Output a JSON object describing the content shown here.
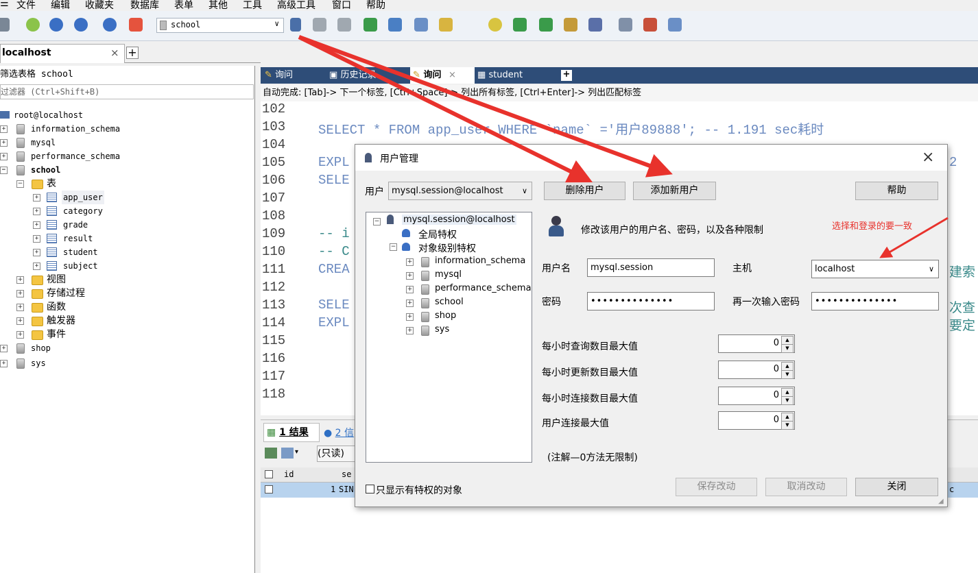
{
  "menu": [
    "文件",
    "编辑",
    "收藏夹",
    "数据库",
    "表单",
    "其他",
    "工具",
    "高级工具",
    "窗口",
    "帮助"
  ],
  "toolbar": {
    "db_select": "school"
  },
  "connection_tab": {
    "label": "localhost",
    "close": "×",
    "add": "+"
  },
  "left": {
    "filter_title": "筛选表格 school",
    "filter_placeholder": "过滤器 (Ctrl+Shift+B)",
    "root": "root@localhost",
    "dbs": [
      "information_schema",
      "mysql",
      "performance_schema",
      "school"
    ],
    "school_children": [
      "表",
      "视图",
      "存储过程",
      "函数",
      "触发器",
      "事件"
    ],
    "tables": [
      "app_user",
      "category",
      "grade",
      "result",
      "student",
      "subject"
    ],
    "more_dbs": [
      "shop",
      "sys"
    ]
  },
  "editor": {
    "tabs": [
      "询问",
      "历史记录",
      "询问",
      "student"
    ],
    "autocomplete": "自动完成:  [Tab]-> 下一个标签,  [Ctrl+Space]-> 列出所有标签,  [Ctrl+Enter]-> 列出匹配标签",
    "line_numbers": [
      "102",
      "103",
      "104",
      "105",
      "106",
      "107",
      "108",
      "109",
      "110",
      "111",
      "112",
      "113",
      "114",
      "115",
      "116",
      "117",
      "118"
    ],
    "line103": "SELECT * FROM app_user WHERE `name` ='用户89888'; -- 1.191 sec耗时",
    "line105": "EXPL",
    "line105_tail": "2",
    "line106": "SELE",
    "line109": "-- i",
    "line110": "-- C",
    "line111": "CREA",
    "line111_tail": "建索",
    "line113": "SELE",
    "line113_tail": "次查",
    "line114": "EXPL",
    "line114_tail": "要定"
  },
  "result": {
    "tab1": "1 结果",
    "tab2": "2 信",
    "readonly": "(只读)",
    "col_id": "id",
    "col_se": "se",
    "row_id": "1",
    "row_val": "SIN",
    "row_tail": "c"
  },
  "dialog": {
    "title": "用户管理",
    "close": "×",
    "user_label": "用户",
    "user_value": "mysql.session@localhost",
    "delete_btn": "删除用户",
    "add_btn": "添加新用户",
    "help_btn": "帮助",
    "tree_root": "mysql.session@localhost",
    "tree_global": "全局特权",
    "tree_object": "对象级别特权",
    "tree_dbs": [
      "information_schema",
      "mysql",
      "performance_schema",
      "school",
      "shop",
      "sys"
    ],
    "desc": "修改该用户的用户名、密码，以及各种限制",
    "annotation": "选择和登录的要一致",
    "username_label": "用户名",
    "username_value": "mysql.session",
    "host_label": "主机",
    "host_value": "localhost",
    "password_label": "密码",
    "password_value": "••••••••••••••",
    "password2_label": "再一次输入密码",
    "password2_value": "••••••••••••••",
    "limits": [
      {
        "label": "每小时查询数目最大值",
        "value": "0"
      },
      {
        "label": "每小时更新数目最大值",
        "value": "0"
      },
      {
        "label": "每小时连接数目最大值",
        "value": "0"
      },
      {
        "label": "用户连接最大值",
        "value": "0"
      }
    ],
    "note": "(注解—0方法无限制)",
    "only_priv_checkbox": "只显示有特权的对象",
    "save_btn": "保存改动",
    "cancel_btn": "取消改动",
    "close_btn": "关闭"
  },
  "colors": {
    "arrow": "#e8322c",
    "annotation": "#e8322c",
    "tabbar": "#2e4d78"
  }
}
